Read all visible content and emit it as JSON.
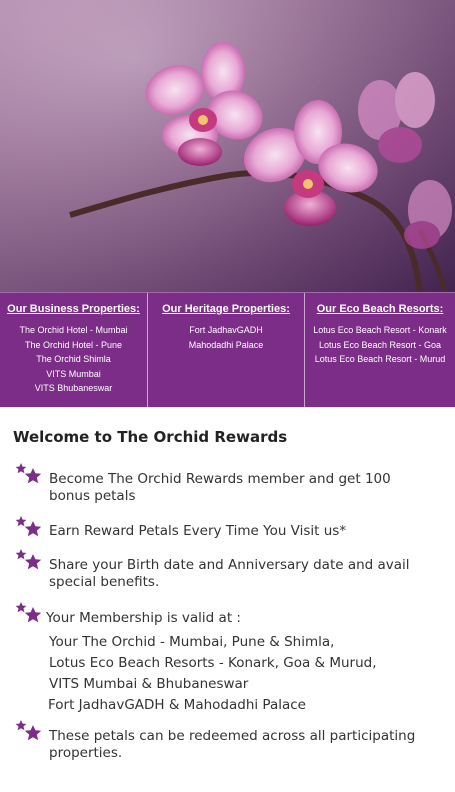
{
  "columns": [
    {
      "heading": "Our Business Properties:",
      "items": [
        "The Orchid Hotel - Mumbai",
        "The Orchid Hotel - Pune",
        "The Orchid Shimla",
        "VITS Mumbai",
        "VITS Bhubaneswar"
      ]
    },
    {
      "heading": "Our Heritage Properties:",
      "items": [
        "Fort JadhavGADH",
        "Mahodadhi Palace"
      ]
    },
    {
      "heading": "Our Eco Beach Resorts:",
      "items": [
        "Lotus Eco Beach Resort - Konark",
        "Lotus Eco Beach Resort - Goa",
        "Lotus Eco Beach Resort - Murud"
      ]
    }
  ],
  "welcome_title": "Welcome to The Orchid Rewards",
  "bullets": [
    {
      "lines": [
        "Become The Orchid Rewards member and get 100",
        "bonus petals"
      ]
    },
    {
      "lines": [
        "Earn Reward Petals Every Time You Visit us*"
      ]
    },
    {
      "lines": [
        "Share your Birth date and Anniversary date and avail",
        "special benefits."
      ]
    },
    {
      "lines": [
        "Your Membership is valid at :"
      ],
      "sublines": [
        "Your The Orchid - Mumbai, Pune & Shimla,",
        "Lotus Eco Beach Resorts - Konark, Goa & Murud,",
        "VITS Mumbai & Bhubaneswar",
        "Fort JadhavGADH & Mahodadhi Palace"
      ]
    },
    {
      "lines": [
        "These petals can be redeemed across all participating",
        "properties."
      ]
    }
  ],
  "colors": {
    "band": "#7b2d87",
    "star": "#7b2d87"
  },
  "icons": {
    "bullet": "double-star-icon",
    "hero": "orchid-photo"
  }
}
